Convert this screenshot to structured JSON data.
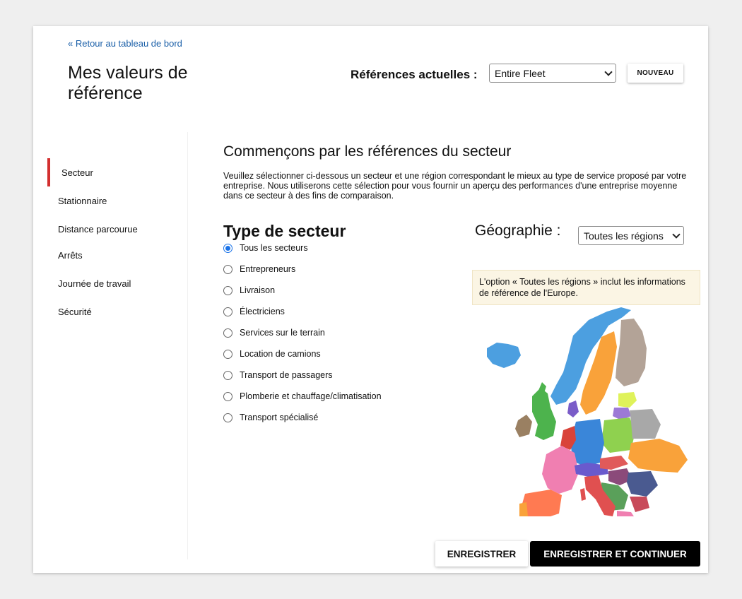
{
  "header": {
    "back_link": "« Retour au tableau de bord",
    "title": "Mes valeurs de référence",
    "current_refs_label": "Références actuelles :",
    "current_refs_value": "Entire Fleet",
    "new_button": "NOUVEAU"
  },
  "sidebar": {
    "items": [
      {
        "label": "Secteur",
        "active": true
      },
      {
        "label": "Stationnaire",
        "active": false
      },
      {
        "label": "Distance parcourue",
        "active": false
      },
      {
        "label": "Arrêts",
        "active": false
      },
      {
        "label": "Journée de travail",
        "active": false
      },
      {
        "label": "Sécurité",
        "active": false
      }
    ]
  },
  "main": {
    "section_title": "Commençons par les références du secteur",
    "intro": "Veuillez sélectionner ci-dessous un secteur et une région correspondant le mieux au type de service proposé par votre entreprise. Nous utiliserons cette sélection pour vous fournir un aperçu des performances d'une entreprise moyenne dans ce secteur à des fins de comparaison.",
    "sector_heading": "Type de secteur",
    "sectors": [
      {
        "label": "Tous les secteurs",
        "selected": true
      },
      {
        "label": "Entrepreneurs",
        "selected": false
      },
      {
        "label": "Livraison",
        "selected": false
      },
      {
        "label": "Électriciens",
        "selected": false
      },
      {
        "label": "Services sur le terrain",
        "selected": false
      },
      {
        "label": "Location de camions",
        "selected": false
      },
      {
        "label": "Transport de passagers",
        "selected": false
      },
      {
        "label": "Plomberie et chauffage/climatisation",
        "selected": false
      },
      {
        "label": "Transport spécialisé",
        "selected": false
      }
    ],
    "geography_label": "Géographie :",
    "geography_value": "Toutes les régions",
    "info_text": "L'option « Toutes les régions » inclut les informations de référence de l'Europe.",
    "map_icon": "europe-map"
  },
  "footer": {
    "save": "ENREGISTRER",
    "save_continue": "ENREGISTRER ET CONTINUER"
  },
  "colors": {
    "link": "#1a5fa8",
    "active_bar": "#d32f2f",
    "radio_selected": "#1a73e8",
    "info_bg": "#fbf5e4",
    "primary_button": "#000000"
  }
}
